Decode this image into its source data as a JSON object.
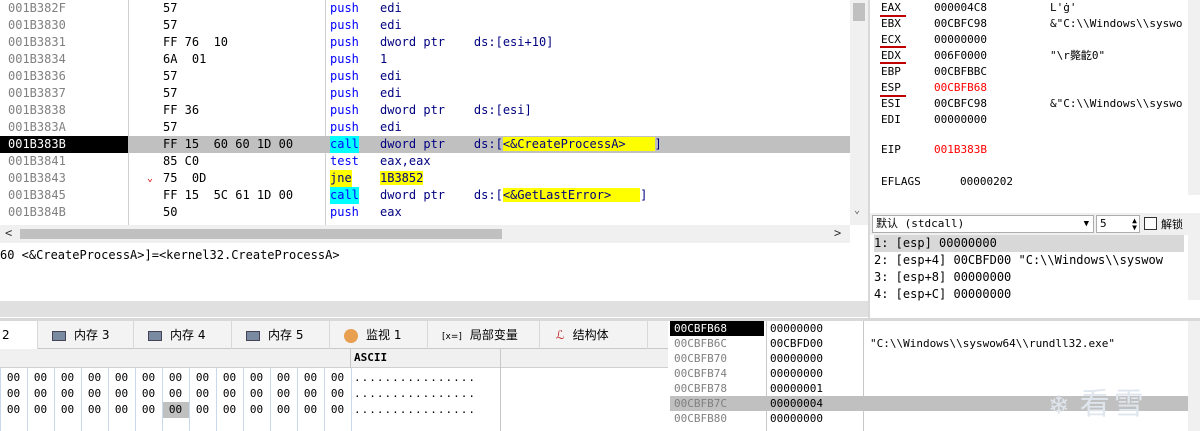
{
  "disasm": {
    "rows": [
      {
        "addr": "001B382F",
        "bytes": "57",
        "mn": "push",
        "ops": "edi"
      },
      {
        "addr": "001B3830",
        "bytes": "57",
        "mn": "push",
        "ops": "edi"
      },
      {
        "addr": "001B3831",
        "bytes": "FF 76  10",
        "mn": "push",
        "ops": "dword ptr    ds:[esi+10]"
      },
      {
        "addr": "001B3834",
        "bytes": "6A  01",
        "mn": "push",
        "ops": "1"
      },
      {
        "addr": "001B3836",
        "bytes": "57",
        "mn": "push",
        "ops": "edi"
      },
      {
        "addr": "001B3837",
        "bytes": "57",
        "mn": "push",
        "ops": "edi"
      },
      {
        "addr": "001B3838",
        "bytes": "FF 36",
        "mn": "push",
        "ops": "dword ptr    ds:[esi]"
      },
      {
        "addr": "001B383A",
        "bytes": "57",
        "mn": "push",
        "ops": "edi"
      },
      {
        "addr": "001B383B",
        "bytes": "FF 15  60 60 1D 00",
        "mn": "call",
        "ops_pre": "dword ptr    ds:[",
        "ops_hl": "<&CreateProcessA>    ",
        "ops_post": "]"
      },
      {
        "addr": "001B3841",
        "bytes": "85 C0",
        "mn": "test",
        "ops": "eax,eax"
      },
      {
        "addr": "001B3843",
        "arrow": "⌄",
        "bytes": "75  0D",
        "mn": "jne",
        "ops_hl": "1B3852"
      },
      {
        "addr": "001B3845",
        "bytes": "FF 15  5C 61 1D 00",
        "mn": "call",
        "ops_pre": "dword ptr    ds:[",
        "ops_hl": "<&GetLastError>    ",
        "ops_post": "]"
      },
      {
        "addr": "001B384B",
        "bytes": "50",
        "mn": "push",
        "ops": "eax"
      }
    ]
  },
  "registers": [
    {
      "name": "EAX",
      "value": "000004C8",
      "comment": "L'ġ'"
    },
    {
      "name": "EBX",
      "value": "00CBFC98",
      "comment": "&\"C:\\\\Windows\\\\syswo"
    },
    {
      "name": "ECX",
      "value": "00000000",
      "comment": ""
    },
    {
      "name": "EDX",
      "value": "006F0000",
      "comment": "\"\\r斃齕0\""
    },
    {
      "name": "EBP",
      "value": "00CBFBBC",
      "comment": ""
    },
    {
      "name": "ESP",
      "value": "00CBFB68",
      "comment": ""
    },
    {
      "name": "ESI",
      "value": "00CBFC98",
      "comment": "&\"C:\\\\Windows\\\\syswo"
    },
    {
      "name": "EDI",
      "value": "00000000",
      "comment": ""
    },
    {
      "name": "EIP",
      "value": "001B383B",
      "comment": ""
    },
    {
      "name": "EFLAGS",
      "value": "00000202",
      "comment": ""
    }
  ],
  "callconv": {
    "label": "默认 (stdcall)",
    "count": "5",
    "unlock_label": "解锁"
  },
  "callstack": [
    "1: [esp] 00000000",
    "2: [esp+4] 00CBFD00 \"C:\\\\Windows\\\\syswow",
    "3: [esp+8] 00000000",
    "4: [esp+C] 00000000"
  ],
  "info": {
    "line": "60 <&CreateProcessA>]=<kernel32.CreateProcessA>"
  },
  "tabs": [
    {
      "label": "2",
      "icon": "dump-icon"
    },
    {
      "label": "内存 3",
      "icon": "memory-icon"
    },
    {
      "label": "内存 4",
      "icon": "memory-icon"
    },
    {
      "label": "内存 5",
      "icon": "memory-icon"
    },
    {
      "label": "监视 1",
      "icon": "watch-icon"
    },
    {
      "label": "局部变量",
      "icon": "locals-icon",
      "prefix": "[x=]"
    },
    {
      "label": "结构体",
      "icon": "struct-icon"
    }
  ],
  "dump": {
    "ascii_header": "ASCII",
    "rows": [
      {
        "bytes": [
          "00",
          "00",
          "00",
          "00",
          "00",
          "00",
          "00",
          "00",
          "00",
          "00",
          "00",
          "00",
          "00"
        ],
        "ascii": "................"
      },
      {
        "bytes": [
          "00",
          "00",
          "00",
          "00",
          "00",
          "00",
          "00",
          "00",
          "00",
          "00",
          "00",
          "00",
          "00"
        ],
        "ascii": "................"
      },
      {
        "bytes": [
          "00",
          "00",
          "00",
          "00",
          "00",
          "00",
          "00",
          "00",
          "00",
          "00",
          "00",
          "00",
          "00"
        ],
        "ascii": "................"
      }
    ]
  },
  "stack": {
    "rows": [
      {
        "addr": "00CBFB68",
        "value": "00000000",
        "comment": ""
      },
      {
        "addr": "00CBFB6C",
        "value": "00CBFD00",
        "comment": "\"C:\\\\Windows\\\\syswow64\\\\rundll32.exe\""
      },
      {
        "addr": "00CBFB70",
        "value": "00000000",
        "comment": ""
      },
      {
        "addr": "00CBFB74",
        "value": "00000000",
        "comment": ""
      },
      {
        "addr": "00CBFB78",
        "value": "00000001",
        "comment": ""
      },
      {
        "addr": "00CBFB7C",
        "value": "00000004",
        "comment": ""
      },
      {
        "addr": "00CBFB80",
        "value": "00000000",
        "comment": ""
      }
    ],
    "watermark": "看雪"
  }
}
